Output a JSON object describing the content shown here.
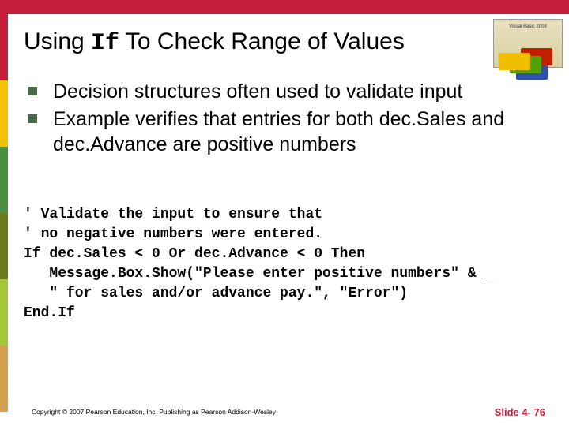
{
  "title": {
    "prefix": "Using ",
    "code": "If",
    "suffix": " To Check Range of Values"
  },
  "bullets": [
    "Decision structures often used to validate input",
    "Example verifies that entries for both dec.Sales and dec.Advance are positive numbers"
  ],
  "code_lines": [
    "' Validate the input to ensure that",
    "' no negative numbers were entered.",
    "If dec.Sales < 0 Or dec.Advance < 0 Then",
    "   Message.Box.Show(\"Please enter positive numbers\" & _",
    "   \" for sales and/or advance pay.\", \"Error\")",
    "End.If"
  ],
  "book_label": "Visual Basic 2008",
  "copyright": "Copyright © 2007 Pearson Education, Inc. Publishing as Pearson Addison-Wesley",
  "slide_number": "Slide 4- 76"
}
